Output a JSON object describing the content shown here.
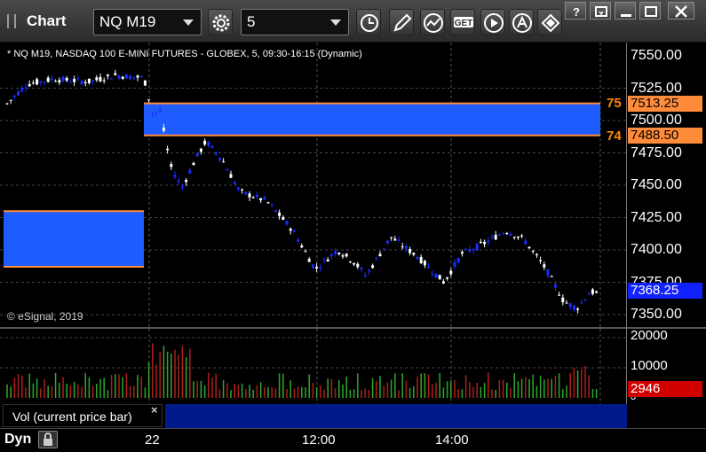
{
  "toolbar": {
    "title": "Chart",
    "symbol": "NQ M19",
    "interval": "5",
    "get_label": "GET"
  },
  "chart": {
    "info": "* NQ M19, NASDAQ 100 E-MINI FUTURES - GLOBEX, 5, 09:30-16:15 (Dynamic)",
    "copyright": "© eSignal, 2019",
    "price_axis": [
      "7550.00",
      "7525.00",
      "7500.00",
      "7475.00",
      "7450.00",
      "7425.00",
      "7400.00",
      "7375.00",
      "7350.00"
    ],
    "volume_axis": [
      "20000",
      "10000",
      "0"
    ],
    "time_axis": [
      "22",
      "12:00",
      "14:00"
    ],
    "last_price": "7368.25",
    "last_volume": "2946",
    "levels": [
      {
        "name": "75",
        "price": "7513.25"
      },
      {
        "name": "74",
        "price": "7488.50"
      }
    ],
    "colors": {
      "zone": "#1e5cff",
      "zone_border": "#ff8c3a",
      "up_candle": "#ffffff",
      "down_candle": "#1a2cff",
      "vol_up": "#2ea82e",
      "vol_down": "#b01e1e",
      "last_price_tag": "#1022ff",
      "last_volume_tag": "#d00000"
    }
  },
  "study": {
    "label": "Vol (current price bar)",
    "close": "×"
  },
  "bottom": {
    "dyn": "Dyn"
  }
}
